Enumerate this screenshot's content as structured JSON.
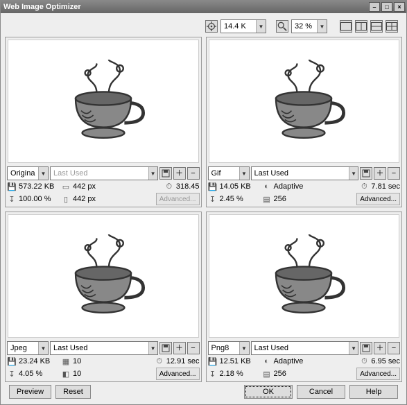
{
  "title": "Web Image Optimizer",
  "toolbar": {
    "modem_value": "14.4 K",
    "zoom_value": "32 %"
  },
  "panels": [
    {
      "format": "Original",
      "preset": "Last Used",
      "preset_disabled": true,
      "size": "573.22 KB",
      "stat_a_icon": "width-icon",
      "stat_a": "442 px",
      "stat_b_icon": "timer-icon",
      "stat_b": "318.45",
      "percent": "100.00 %",
      "stat_c_icon": "height-icon",
      "stat_c": "442 px",
      "advanced_disabled": true
    },
    {
      "format": "Gif",
      "preset": "Last Used",
      "preset_disabled": false,
      "size": "14.05 KB",
      "stat_a_icon": "palette-icon",
      "stat_a": "Adaptive",
      "stat_b_icon": "timer-icon",
      "stat_b": "7.81 sec",
      "percent": "2.45 %",
      "stat_c_icon": "colors-icon",
      "stat_c": "256",
      "advanced_disabled": false
    },
    {
      "format": "Jpeg",
      "preset": "Last Used",
      "preset_disabled": false,
      "size": "23.24 KB",
      "stat_a_icon": "quality-icon",
      "stat_a": "10",
      "stat_b_icon": "timer-icon",
      "stat_b": "12.91 sec",
      "percent": "4.05 %",
      "stat_c_icon": "smooth-icon",
      "stat_c": "10",
      "advanced_disabled": false
    },
    {
      "format": "Png8",
      "preset": "Last Used",
      "preset_disabled": false,
      "size": "12.51 KB",
      "stat_a_icon": "palette-icon",
      "stat_a": "Adaptive",
      "stat_b_icon": "timer-icon",
      "stat_b": "6.95 sec",
      "percent": "2.18 %",
      "stat_c_icon": "colors-icon",
      "stat_c": "256",
      "advanced_disabled": false
    }
  ],
  "buttons": {
    "preview": "Preview",
    "reset": "Reset",
    "ok": "OK",
    "cancel": "Cancel",
    "help": "Help",
    "advanced": "Advanced..."
  }
}
